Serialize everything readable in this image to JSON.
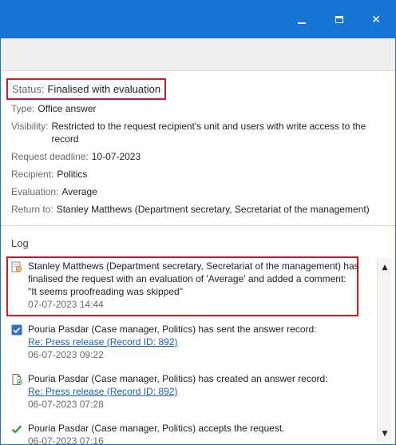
{
  "window": {
    "minimize_icon": "minimize-icon",
    "maximize_icon": "maximize-icon",
    "close_icon": "close-icon",
    "accent": "#1574d4"
  },
  "details": {
    "status": {
      "label": "Status:",
      "value": "Finalised with evaluation"
    },
    "type": {
      "label": "Type:",
      "value": "Office answer"
    },
    "visibility": {
      "label": "Visibility:",
      "value": "Restricted to the request recipient's unit and users with write access to the record"
    },
    "deadline": {
      "label": "Request deadline:",
      "value": "10-07-2023"
    },
    "recipient": {
      "label": "Recipient:",
      "value": "Politics"
    },
    "evaluation": {
      "label": "Evaluation:",
      "value": "Average"
    },
    "return_to": {
      "label": "Return to:",
      "value": "Stanley Matthews (Department secretary, Secretariat of the management)"
    }
  },
  "log": {
    "title": "Log",
    "entries": [
      {
        "icon": "request-finalised-icon",
        "lines": [
          "Stanley Matthews (Department secretary, Secretariat of the management) has",
          "finalised the request with an evaluation of 'Average' and added a comment:",
          "\"It seems proofreading was skipped\""
        ],
        "date": "07-07-2023 14:44"
      },
      {
        "icon": "checkbox-checked-icon",
        "text": "Pouria Pasdar (Case manager, Politics) has sent the answer record:",
        "link": "Re: Press release (Record ID: 892)",
        "date": "06-07-2023 09:22"
      },
      {
        "icon": "document-add-icon",
        "text": "Pouria Pasdar (Case manager, Politics) has created an answer record:",
        "link": "Re: Press release (Record ID: 892)",
        "date": "06-07-2023 07:28"
      },
      {
        "icon": "checkmark-icon",
        "text": "Pouria Pasdar (Case manager, Politics) accepts the request.",
        "date": "06-07-2023 07:16"
      }
    ]
  },
  "colors": {
    "highlight": "#e0101e",
    "link": "#1a5fb4",
    "label": "#6a6a6a",
    "check_green": "#3f9a50"
  }
}
